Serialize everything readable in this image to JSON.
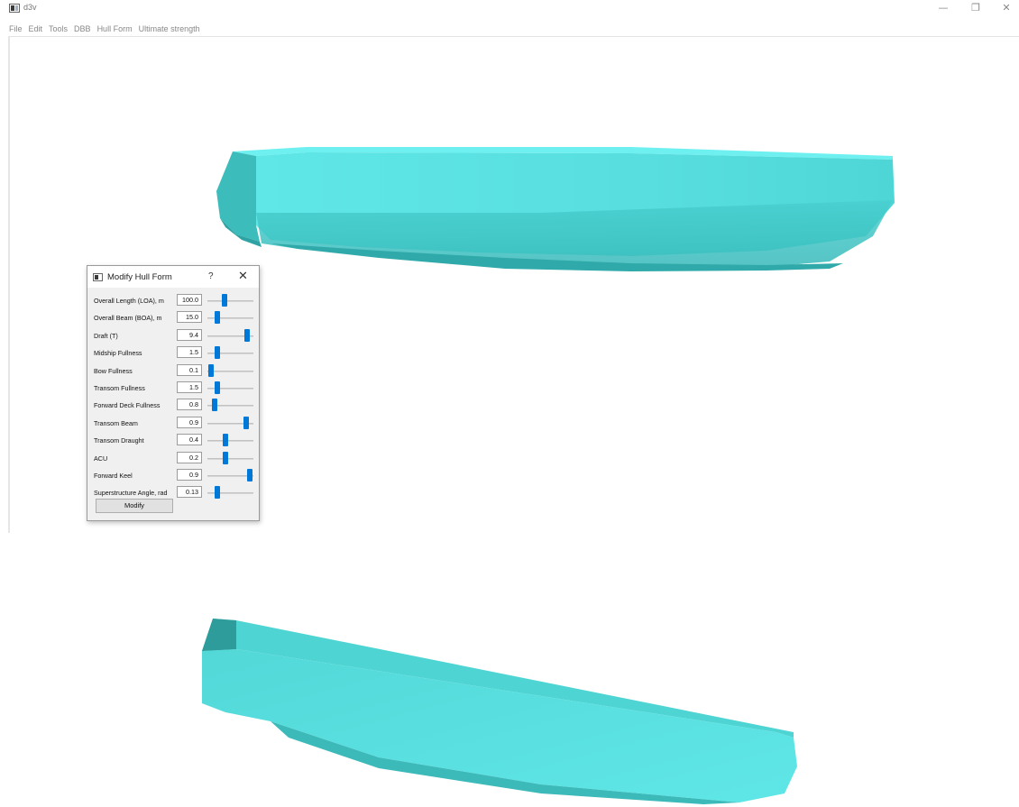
{
  "window": {
    "title": "d3v",
    "controls": {
      "minimize": "—",
      "maximize": "❐",
      "close": "✕"
    }
  },
  "menu": {
    "items": [
      "File",
      "Edit",
      "Tools",
      "DBB",
      "Hull Form",
      "Ultimate strength"
    ]
  },
  "viewport": {
    "hull_color": "#5ee3e3"
  },
  "dialog": {
    "title": "Modify Hull Form",
    "help": "?",
    "close": "✕",
    "rows": [
      {
        "label": "Overall Length (LOA), m",
        "value": "100.0",
        "slider": 0.35
      },
      {
        "label": "Overall Beam (BOA), m",
        "value": "15.0",
        "slider": 0.18
      },
      {
        "label": "Draft (T)",
        "value": "9.4",
        "slider": 0.92
      },
      {
        "label": "Midship Fullness",
        "value": "1.5",
        "slider": 0.18
      },
      {
        "label": "Bow Fullness",
        "value": "0.1",
        "slider": 0.02
      },
      {
        "label": "Transom Fullness",
        "value": "1.5",
        "slider": 0.18
      },
      {
        "label": "Forward Deck Fullness",
        "value": "0.8",
        "slider": 0.11
      },
      {
        "label": "Transom Beam",
        "value": "0.9",
        "slider": 0.88
      },
      {
        "label": "Transom Draught",
        "value": "0.4",
        "slider": 0.38
      },
      {
        "label": "ACU",
        "value": "0.2",
        "slider": 0.38
      },
      {
        "label": "Forward Keel",
        "value": "0.9",
        "slider": 0.98
      },
      {
        "label": "Superstructure Angle, rad",
        "value": "0.13",
        "slider": 0.18
      }
    ],
    "button_label": "Modify"
  }
}
